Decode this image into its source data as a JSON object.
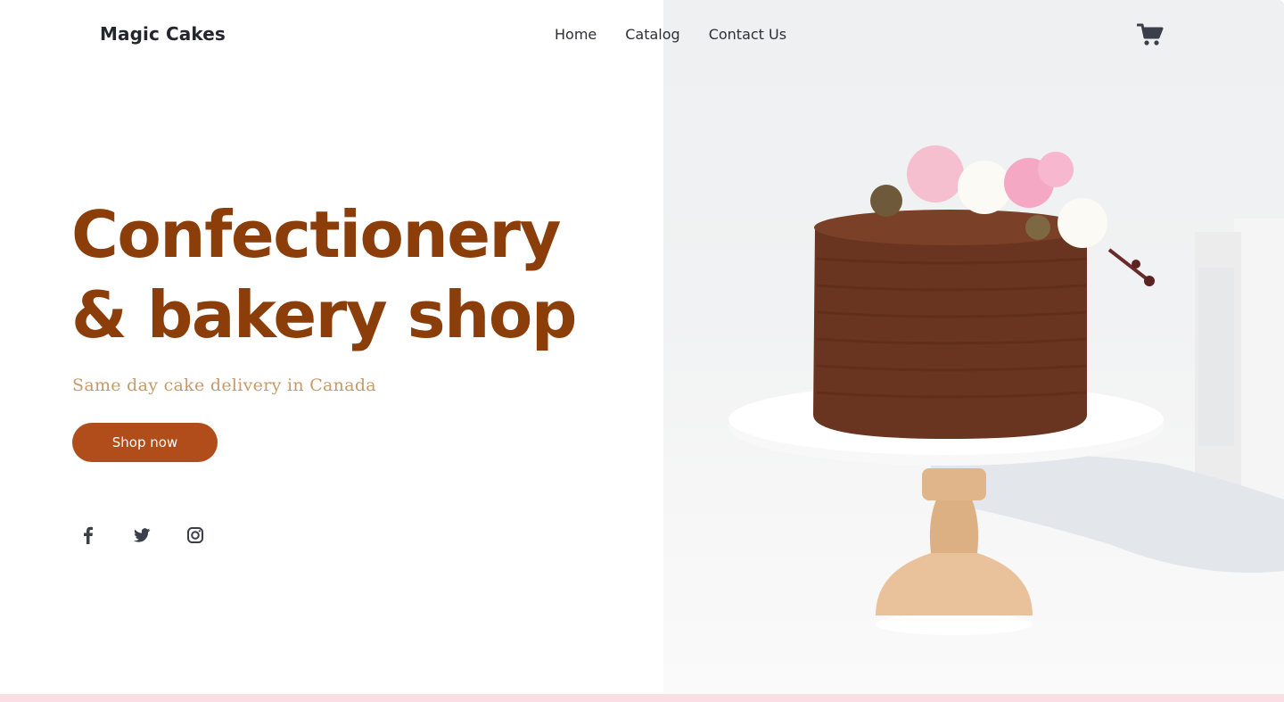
{
  "brand": {
    "name": "Magic Cakes"
  },
  "nav": {
    "items": [
      {
        "label": "Home"
      },
      {
        "label": "Catalog"
      },
      {
        "label": "Contact Us"
      }
    ]
  },
  "cart": {
    "icon": "cart-icon"
  },
  "hero": {
    "headline": "Confectionery & bakery shop",
    "subtitle": "Same day cake delivery in Canada",
    "cta_label": "Shop now",
    "image": "chocolate-cake-on-stand"
  },
  "social": {
    "icons": [
      "facebook-icon",
      "twitter-icon",
      "instagram-icon"
    ]
  },
  "colors": {
    "headline": "#8b3e0a",
    "subtitle": "#c69a6a",
    "cta": "#b04d1a",
    "footer_strip": "#fbdde5",
    "text_dark": "#2d2d33"
  }
}
